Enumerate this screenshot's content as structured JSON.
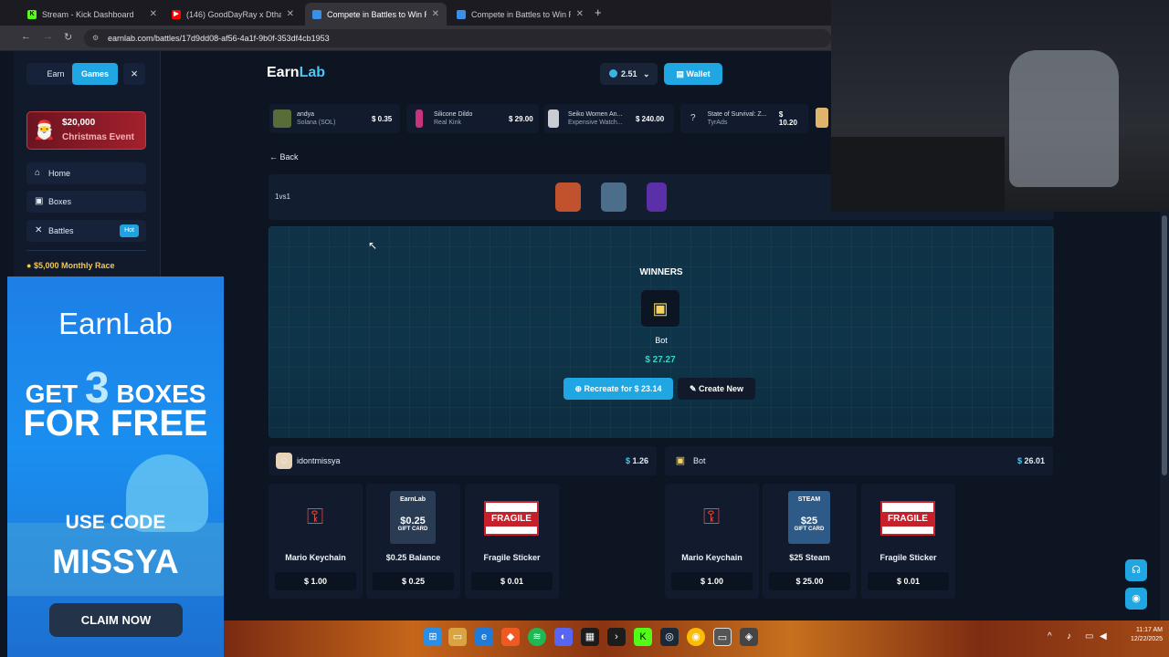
{
  "browser": {
    "tabs": [
      {
        "title": "Stream - Kick Dashboard",
        "fav_color": "#53fc18"
      },
      {
        "title": "(146) GoodDayRay x Dthang G...",
        "fav_color": "#ff0000"
      },
      {
        "title": "Compete in Battles to Win Rew...",
        "fav_color": "#3b8fe8"
      },
      {
        "title": "Compete in Battles to Win Rew...",
        "fav_color": "#3b8fe8"
      }
    ],
    "url": "earnlab.com/battles/17d9dd08-af56-4a1f-9b0f-353df4cb1953"
  },
  "sidebar": {
    "segment_earn": "Earn",
    "segment_games": "Games",
    "close": "×",
    "event_amount": "$20,000",
    "event_label": "Christmas Event",
    "nav": [
      {
        "label": "Home",
        "icon": "home-icon"
      },
      {
        "label": "Boxes",
        "icon": "box-icon"
      },
      {
        "label": "Battles",
        "icon": "swords-icon",
        "badge": "Hot"
      }
    ],
    "race": "$5,000 Monthly Race"
  },
  "header": {
    "logo_a": "Earn",
    "logo_b": "Lab",
    "balance": "2.51",
    "wallet": "Wallet"
  },
  "drops": [
    {
      "title": "andya",
      "sub": "Solana (SOL)",
      "price": "$ 0.35",
      "color": "#5a6b3a"
    },
    {
      "title": "Silicone Dildo",
      "sub": "Real Kink",
      "price": "$ 29.00",
      "color": "#c8337d"
    },
    {
      "title": "Seiko Women An...",
      "sub": "Expensive Watch...",
      "price": "$ 240.00",
      "color": "#c9ccd2"
    },
    {
      "title": "State of Survival: Z...",
      "sub": "TyrAds",
      "price": "$ 10.20",
      "color": "#121b2d"
    }
  ],
  "battle": {
    "back": "Back",
    "mode": "1vs1",
    "cases": [
      {
        "color": "#c0522e"
      },
      {
        "color": "#4d6e8a"
      },
      {
        "color": "#5b2fa8"
      }
    ],
    "winners_label": "WINNERS",
    "winner_name": "Bot",
    "winner_amount": "$ 27.27",
    "recreate": "Recreate for $ 23.14",
    "create_new": "Create New"
  },
  "players": [
    {
      "name": "idontmissya",
      "total": "1.26",
      "items": [
        {
          "name": "Mario Keychain",
          "price": "$ 1.00",
          "art": "key"
        },
        {
          "name": "$0.25 Balance",
          "price": "$ 0.25",
          "art": "gift",
          "gift_top": "EarnLab",
          "gift_value": "$0.25",
          "gift_sub": "GIFT CARD",
          "gift_color": "#2a3b54"
        },
        {
          "name": "Fragile Sticker",
          "price": "$ 0.01",
          "art": "fragile",
          "sticker": "FRAGILE"
        }
      ]
    },
    {
      "name": "Bot",
      "total": "26.01",
      "items": [
        {
          "name": "Mario Keychain",
          "price": "$ 1.00",
          "art": "key"
        },
        {
          "name": "$25 Steam",
          "price": "$ 25.00",
          "art": "gift",
          "gift_top": "STEAM",
          "gift_value": "$25",
          "gift_sub": "GIFT CARD",
          "gift_color": "#2d5a86"
        },
        {
          "name": "Fragile Sticker",
          "price": "$ 0.01",
          "art": "fragile",
          "sticker": "FRAGILE"
        }
      ]
    }
  ],
  "promo": {
    "brand": "EarnLab",
    "line1a": "GET",
    "line1b": "3",
    "line1c": "BOXES",
    "line2": "FOR FREE",
    "use_code": "USE CODE",
    "code": "MISSYA",
    "claim": "CLAIM NOW"
  },
  "taskbar": {
    "time": "11:17 AM",
    "date": "12/22/2025"
  }
}
